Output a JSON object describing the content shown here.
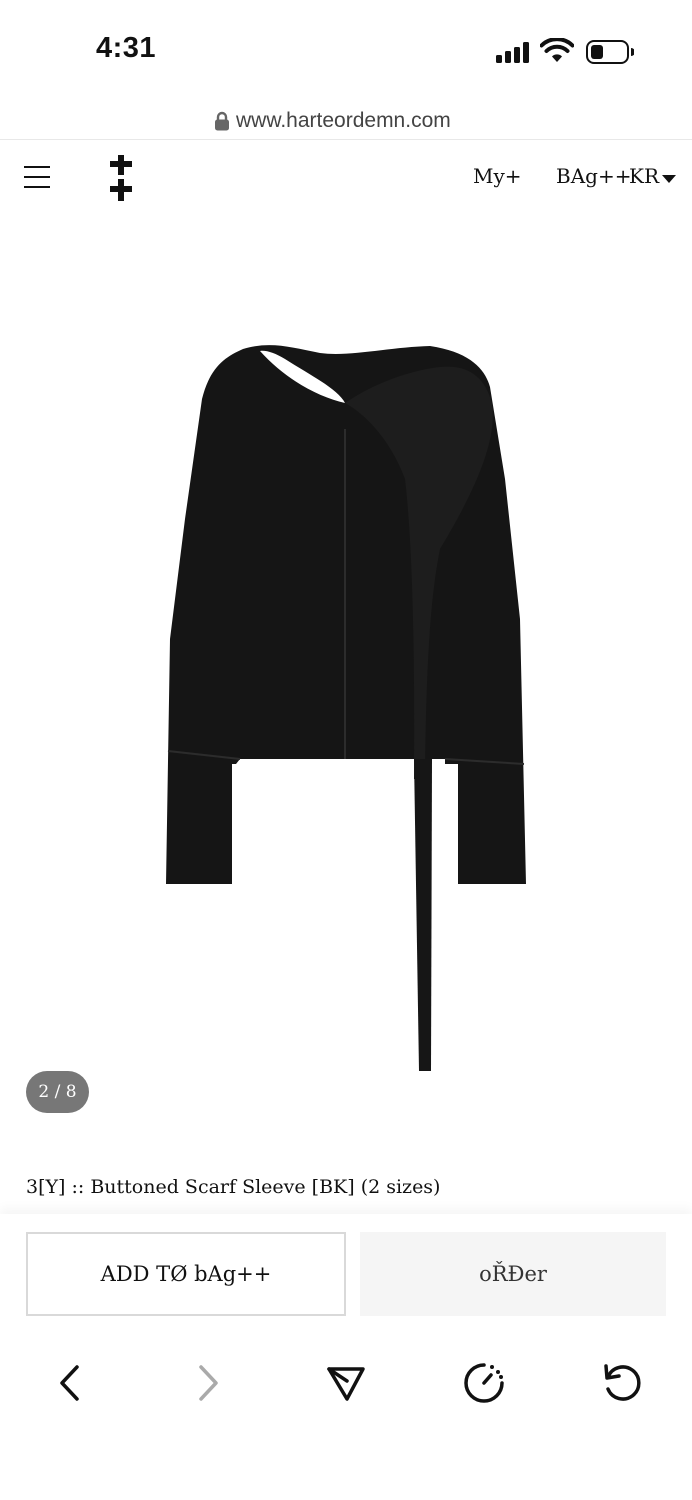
{
  "status_bar": {
    "time": "4:31"
  },
  "browser": {
    "url": "www.harteordemn.com"
  },
  "header": {
    "nav": {
      "my": "My+",
      "bag": "BAg++",
      "currency": "KR"
    }
  },
  "gallery": {
    "counter": "2 / 8"
  },
  "product": {
    "title": "3[Y] :: Buttoned Scarf Sleeve [BK] (2 sizes)"
  },
  "actions": {
    "add_to_bag": "ADD TØ bAg++",
    "order": "oŘĐer"
  },
  "toolbar": {
    "icons": [
      "back-icon",
      "forward-icon",
      "bookmark-icon",
      "speed-dial-icon",
      "refresh-icon"
    ]
  },
  "colors": {
    "text": "#111111",
    "garment": "#141414",
    "counter_bg": "#777777",
    "order_bg": "#f5f5f5"
  }
}
